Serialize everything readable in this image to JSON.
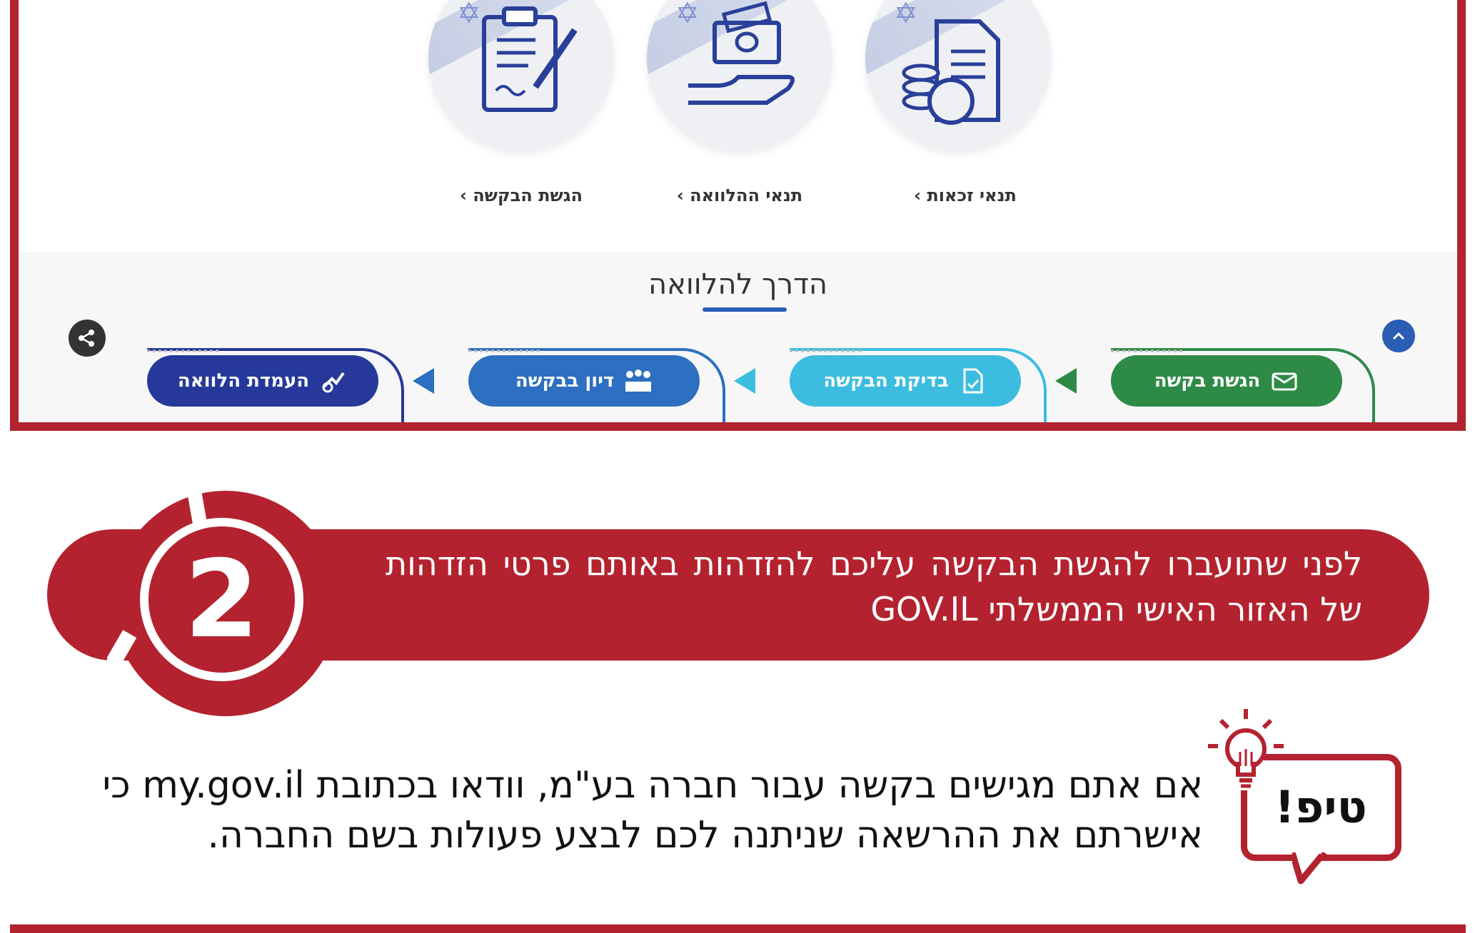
{
  "screenshot": {
    "cards": [
      {
        "label": "תנאי זכאות ›",
        "icon": "documents-coins-icon"
      },
      {
        "label": "תנאי ההלוואה ›",
        "icon": "hand-money-icon"
      },
      {
        "label": "הגשת הבקשה ›",
        "icon": "clipboard-pen-icon"
      }
    ],
    "guide_title": "הדרך להלוואה",
    "steps": [
      {
        "label": "הגשת בקשה",
        "icon": "envelope-form-icon",
        "color": "#2e8b47"
      },
      {
        "label": "בדיקת הבקשה",
        "icon": "document-check-icon",
        "color": "#3cbde0"
      },
      {
        "label": "דיון בבקשה",
        "icon": "meeting-people-icon",
        "color": "#2d6fc0"
      },
      {
        "label": "העמדת הלוואה",
        "icon": "handshake-icon",
        "color": "#26399a"
      }
    ]
  },
  "step": {
    "number": "2",
    "text": "לפני שתועברו להגשת הבקשה עליכם להזדהות באותם פרטי הזדהות של האזור האישי הממשלתי GOV.IL"
  },
  "tip": {
    "label": "טיפ!",
    "text": "אם אתם מגישים בקשה עבור חברה בע\"מ, וודאו בכתובת my.gov.il כי אישרתם את ההרשאה שניתנה לכם לבצע פעולות בשם החברה."
  },
  "colors": {
    "brand_red": "#b4222f",
    "gov_blue": "#2a3f9a"
  }
}
